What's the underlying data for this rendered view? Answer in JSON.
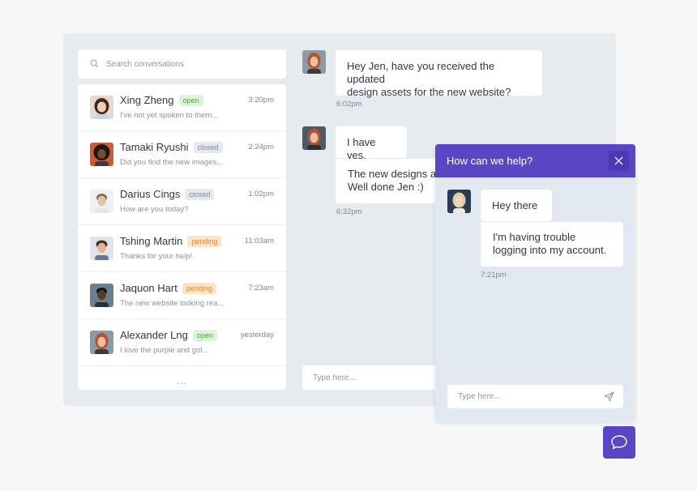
{
  "search": {
    "placeholder": "Search conversations"
  },
  "conversations": [
    {
      "name": "Xing Zheng",
      "status": "open",
      "time": "3:20pm",
      "preview": "I've not yet spoken to them..."
    },
    {
      "name": "Tamaki Ryushi",
      "status": "closed",
      "time": "2:24pm",
      "preview": "Did you find the new images..."
    },
    {
      "name": "Darius Cings",
      "status": "closed",
      "time": "1:02pm",
      "preview": "How are you today?"
    },
    {
      "name": "Tshing Martin",
      "status": "pending",
      "time": "11:03am",
      "preview": "Thanks for your help!"
    },
    {
      "name": "Jaquon Hart",
      "status": "pending",
      "time": "7:23am",
      "preview": "The new website looking rea..."
    },
    {
      "name": "Alexander Lng",
      "status": "open",
      "time": "yesterday",
      "preview": "I love the purple and gol..."
    }
  ],
  "more": "...",
  "chat": {
    "msg1": {
      "text_line1": "Hey Jen, have you received the updated",
      "text_line2": "design assets for the new website?",
      "time": "6:02pm"
    },
    "msg2": {
      "text": "I have yes."
    },
    "msg3": {
      "text_line1": "The new designs ar",
      "text_line2": "Well done Jen :)",
      "time": "6:32pm"
    },
    "input_placeholder": "Type here..."
  },
  "widget": {
    "title": "How can we help?",
    "msg1": "Hey there",
    "msg2_line1": "I'm having trouble",
    "msg2_line2": "logging into my account.",
    "time": "7:21pm",
    "input_placeholder": "Type here..."
  },
  "colors": {
    "accent": "#5a45c4",
    "frame": "#e6ebf0",
    "widget_bg": "#e1e8f0"
  },
  "icons": {
    "search": "search-icon",
    "close": "close-icon",
    "send": "send-icon",
    "launcher": "chat-bubble-icon"
  }
}
